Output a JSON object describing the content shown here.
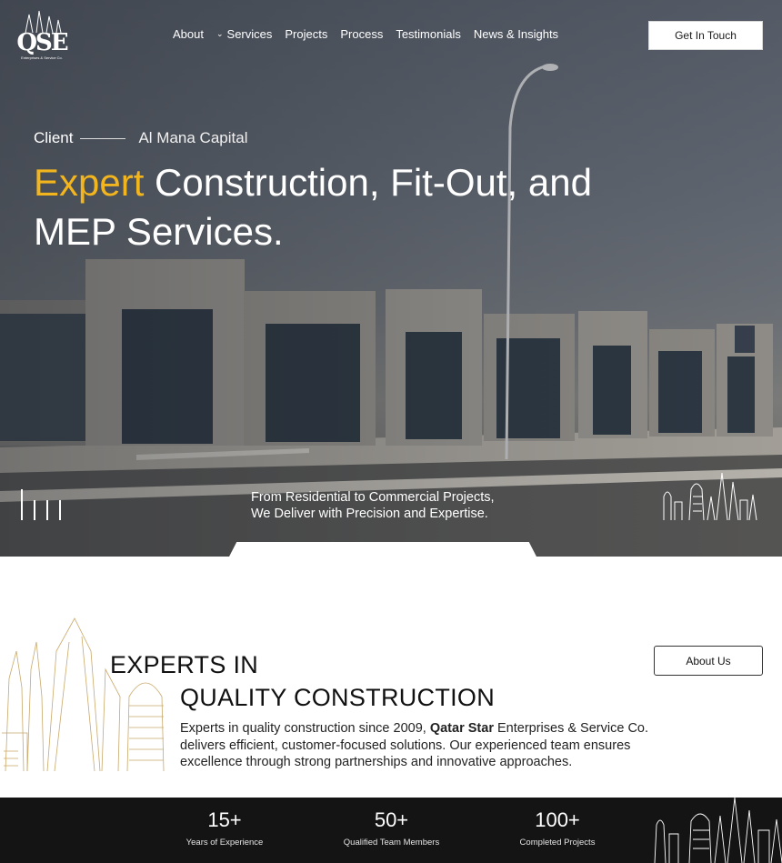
{
  "brand": {
    "logo_text": "QSE",
    "logo_sub": "Enterprises & Service Co."
  },
  "nav": {
    "items": [
      {
        "label": "About",
        "has_dropdown": false
      },
      {
        "label": "Services",
        "has_dropdown": true
      },
      {
        "label": "Projects",
        "has_dropdown": false
      },
      {
        "label": "Process",
        "has_dropdown": false
      },
      {
        "label": "Testimonials",
        "has_dropdown": false
      },
      {
        "label": "News & Insights",
        "has_dropdown": false
      }
    ],
    "cta_label": "Get In Touch"
  },
  "hero": {
    "client_label": "Client",
    "client_name": "Al Mana Capital",
    "title_accent": "Expert",
    "title_rest": " Construction, Fit-Out, and MEP Services.",
    "tagline_line1": "From Residential to Commercial Projects,",
    "tagline_line2": "We Deliver with Precision and Expertise."
  },
  "about": {
    "heading_line1": "EXPERTS IN",
    "heading_line2": "QUALITY CONSTRUCTION",
    "button_label": "About Us",
    "text_before": "Experts in quality construction since 2009, ",
    "text_bold": "Qatar Star",
    "text_after": " Enterprises & Service Co. delivers efficient, customer-focused solutions. Our experienced team ensures excellence through strong partnerships and innovative approaches."
  },
  "stats": [
    {
      "value": "15+",
      "label": "Years of Experience"
    },
    {
      "value": "50+",
      "label": "Qualified Team Members"
    },
    {
      "value": "100+",
      "label": "Completed Projects"
    }
  ],
  "colors": {
    "accent": "#f2b51e",
    "stats_bg": "#141414",
    "gold_line": "#c9a86a"
  }
}
